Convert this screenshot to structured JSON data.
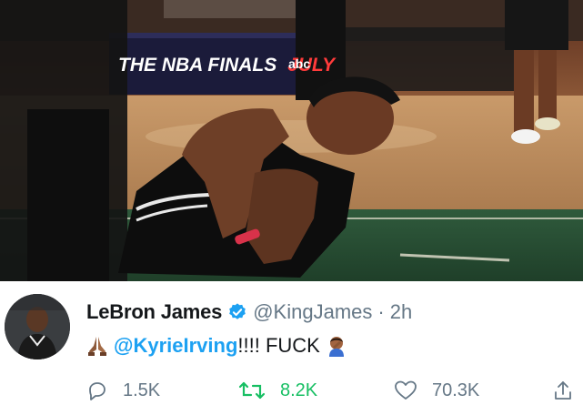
{
  "photo": {
    "banner_text": "THE NBA FINALS",
    "banner_month": "JULY",
    "banner_network": "abc"
  },
  "tweet": {
    "display_name": "LeBron James",
    "verified": true,
    "handle": "@KingJames",
    "separator": "·",
    "time": "2h",
    "text_mention": "@KyrieIrving",
    "text_rest": "!!!! FUCK",
    "emoji_start": "folded-hands",
    "emoji_end": "person-facepalming"
  },
  "actions": {
    "reply_count": "1.5K",
    "retweet_count": "8.2K",
    "like_count": "70.3K"
  },
  "colors": {
    "link": "#1da1f2",
    "retweet_active": "#17bf63",
    "muted": "#657786",
    "text": "#14171a"
  }
}
